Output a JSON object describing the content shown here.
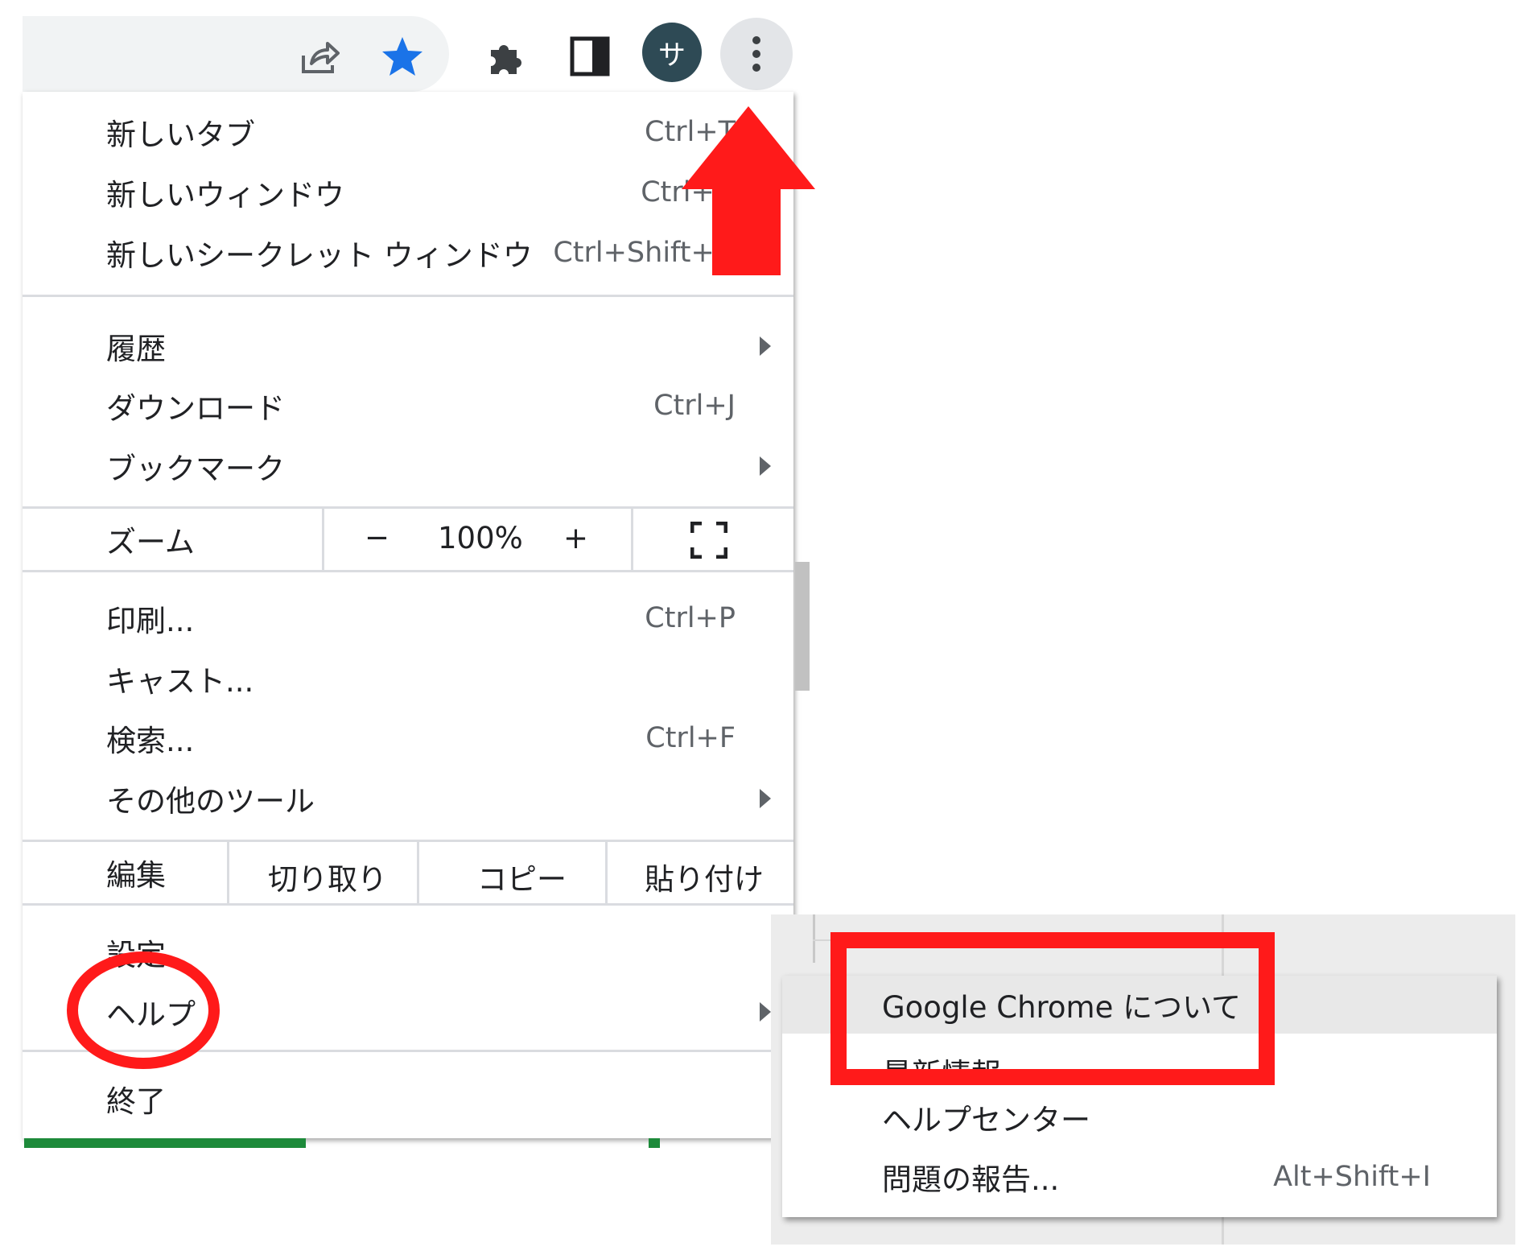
{
  "toolbar": {
    "share_icon": "share-icon",
    "bookmark_icon": "star-icon",
    "extensions_icon": "puzzle-icon",
    "sidepanel_icon": "side-panel-icon",
    "avatar_letter": "サ",
    "menu_icon": "kebab-icon",
    "star_color": "#1a73e8"
  },
  "menu": {
    "new_tab": {
      "label": "新しいタブ",
      "shortcut": "Ctrl+T"
    },
    "new_window": {
      "label": "新しいウィンドウ",
      "shortcut": "Ctrl+N"
    },
    "incognito": {
      "label": "新しいシークレット ウィンドウ",
      "shortcut": "Ctrl+Shift+N"
    },
    "history": {
      "label": "履歴"
    },
    "downloads": {
      "label": "ダウンロード",
      "shortcut": "Ctrl+J"
    },
    "bookmarks": {
      "label": "ブックマーク"
    },
    "zoom": {
      "label": "ズーム",
      "minus": "−",
      "value": "100%",
      "plus": "+"
    },
    "print": {
      "label": "印刷...",
      "shortcut": "Ctrl+P"
    },
    "cast": {
      "label": "キャスト..."
    },
    "find": {
      "label": "検索...",
      "shortcut": "Ctrl+F"
    },
    "more_tools": {
      "label": "その他のツール"
    },
    "edit": {
      "label": "編集",
      "cut": "切り取り",
      "copy": "コピー",
      "paste": "貼り付け"
    },
    "settings": {
      "label": "設定"
    },
    "help": {
      "label": "ヘルプ"
    },
    "exit": {
      "label": "終了"
    }
  },
  "help_submenu": {
    "about": {
      "label": "Google Chrome について"
    },
    "whats_new": {
      "label": "最新情報"
    },
    "help_center": {
      "label": "ヘルプセンター"
    },
    "report_issue": {
      "label": "問題の報告...",
      "shortcut": "Alt+Shift+I"
    }
  },
  "annotations": {
    "color": "#ff1a1a"
  }
}
